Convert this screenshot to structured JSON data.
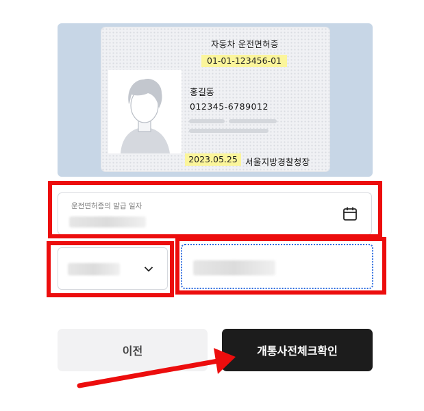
{
  "license": {
    "card_title": "자동차 운전면허증",
    "license_number": "01-01-123456-01",
    "holder_name": "홍길동",
    "holder_id": "012345-6789012",
    "issue_date": "2023.05.25",
    "issuer": "서울지방경찰청장"
  },
  "form": {
    "issue_date_field": {
      "label": "운전면허증의 발급 일자",
      "icon": "calendar-icon"
    },
    "select_field": {
      "icon": "chevron-down-icon"
    }
  },
  "buttons": {
    "prev_label": "이전",
    "confirm_label": "개통사전체크확인"
  },
  "colors": {
    "highlight_yellow": "#fbf59b",
    "annotation_red": "#ec0d0d",
    "confirm_button_bg": "#1c1c1c",
    "focus_blue": "#2d6cdf"
  }
}
